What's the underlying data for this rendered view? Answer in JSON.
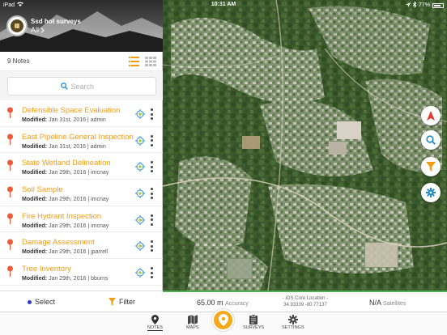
{
  "status_bar": {
    "device": "iPad",
    "time": "10:31 AM",
    "battery": "77%"
  },
  "header": {
    "survey_title": "Ssd hot surveys",
    "filter_label": "All",
    "notes_count": "9 Notes"
  },
  "search": {
    "placeholder": "Search"
  },
  "notes": [
    {
      "title": "Defensible Space Evaluation",
      "modified_label": "Modified:",
      "meta": "Jan 31st, 2016 | admin"
    },
    {
      "title": "East Pipeline General Inspection",
      "modified_label": "Modified:",
      "meta": "Jan 31st, 2016 | admin"
    },
    {
      "title": "State Wetland Delineation",
      "modified_label": "Modified:",
      "meta": "Jan 29th, 2016 | imcnay"
    },
    {
      "title": "Soil Sample",
      "modified_label": "Modified:",
      "meta": "Jan 29th, 2016 | imcnay"
    },
    {
      "title": "Fire Hydrant Inspection",
      "modified_label": "Modified:",
      "meta": "Jan 29th, 2016 | imcnay"
    },
    {
      "title": "Damage Assessment",
      "modified_label": "Modified:",
      "meta": "Jan 29th, 2016 | jparrell"
    },
    {
      "title": "Tree Inventory",
      "modified_label": "Modified:",
      "meta": "Jan 29th, 2016 | bburns"
    }
  ],
  "bottom_left": {
    "select_label": "Select",
    "filter_label": "Filter"
  },
  "map_footer": {
    "accuracy_value": "65.00 m",
    "accuracy_label": "Accuracy",
    "location_title": "- iOS Core Location -",
    "location_coords": "34.93339 -80.77137",
    "satellites_value": "N/A",
    "satellites_label": "Satellites"
  },
  "tabs": [
    {
      "label": "NOTES",
      "icon": "pin-icon"
    },
    {
      "label": "MAPS",
      "icon": "map-icon"
    },
    {
      "label": "SURVEYS",
      "icon": "clipboard-icon"
    },
    {
      "label": "SETTINGS",
      "icon": "gear-icon"
    }
  ],
  "colors": {
    "accent": "#f39c12",
    "map_button_blue": "#1e88c7",
    "compass_red": "#e53935",
    "footer_green": "#4caf50"
  }
}
